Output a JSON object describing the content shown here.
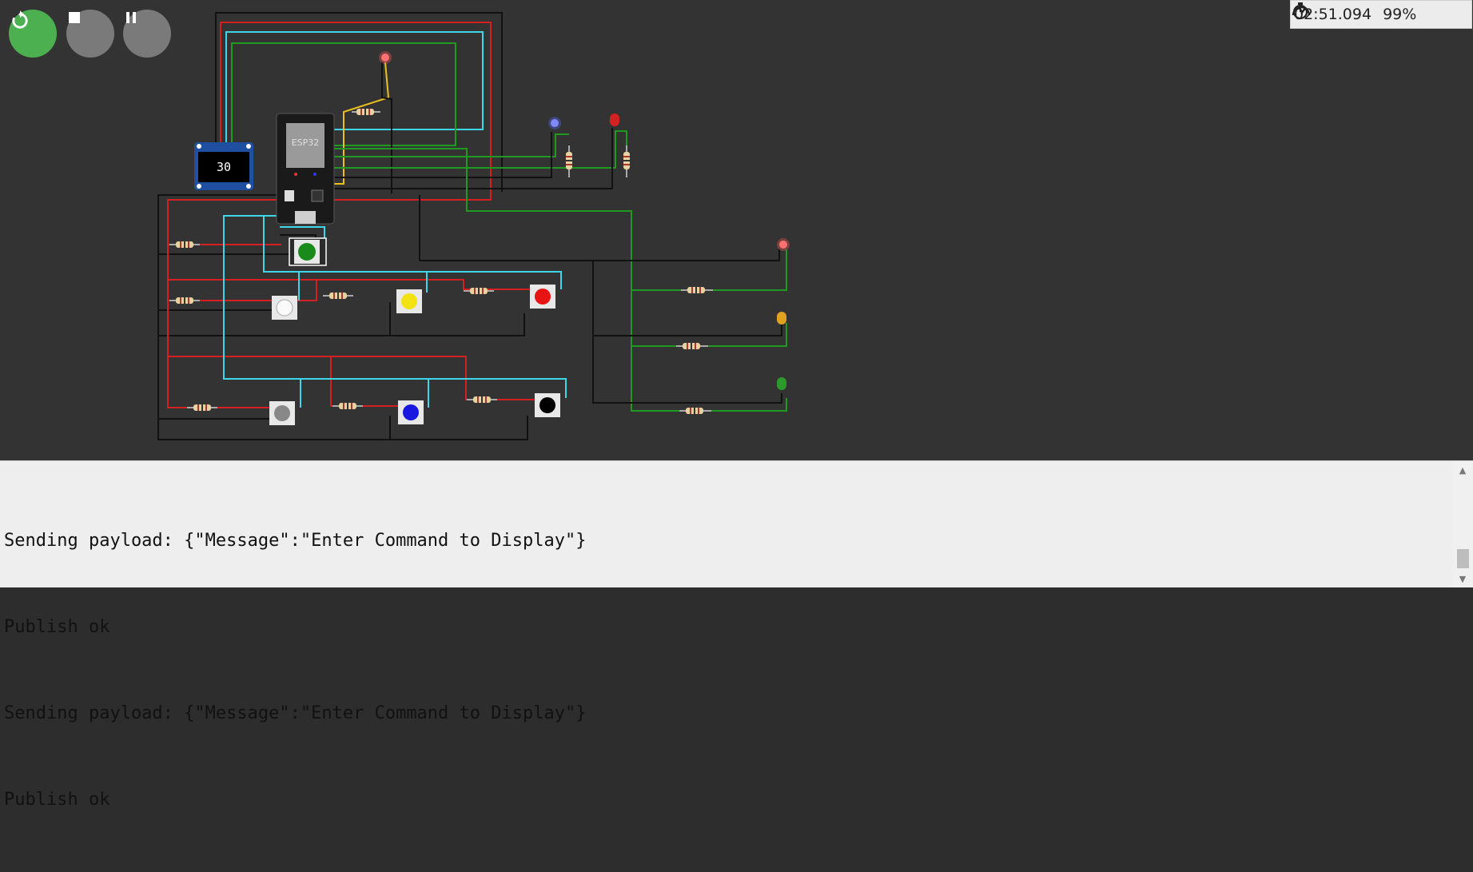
{
  "controls": {
    "restart_icon": "restart-icon",
    "stop_icon": "stop-icon",
    "pause_icon": "pause-icon"
  },
  "status": {
    "timer_icon": "stopwatch-icon",
    "time": "02:51.094",
    "speed_icon": "speedometer-icon",
    "speed": "99%"
  },
  "circuit": {
    "mcu_label": "ESP32",
    "oled_value": "30",
    "colors": {
      "background": "#333333",
      "wire_red": "#d42020",
      "wire_cyan": "#3fd6e8",
      "wire_green": "#1f9a1f",
      "wire_black": "#111111",
      "wire_yellow": "#e8c020"
    },
    "buttons": [
      "green",
      "white",
      "yellow",
      "red",
      "gray",
      "blue",
      "black"
    ],
    "leds": [
      "red",
      "blue",
      "red",
      "red",
      "orange",
      "green"
    ]
  },
  "console": {
    "lines": [
      "Sending payload: {\"Message\":\"Enter Command to Display\"}",
      "Publish ok",
      "Sending payload: {\"Message\":\"Enter Command to Display\"}",
      "Publish ok"
    ]
  }
}
